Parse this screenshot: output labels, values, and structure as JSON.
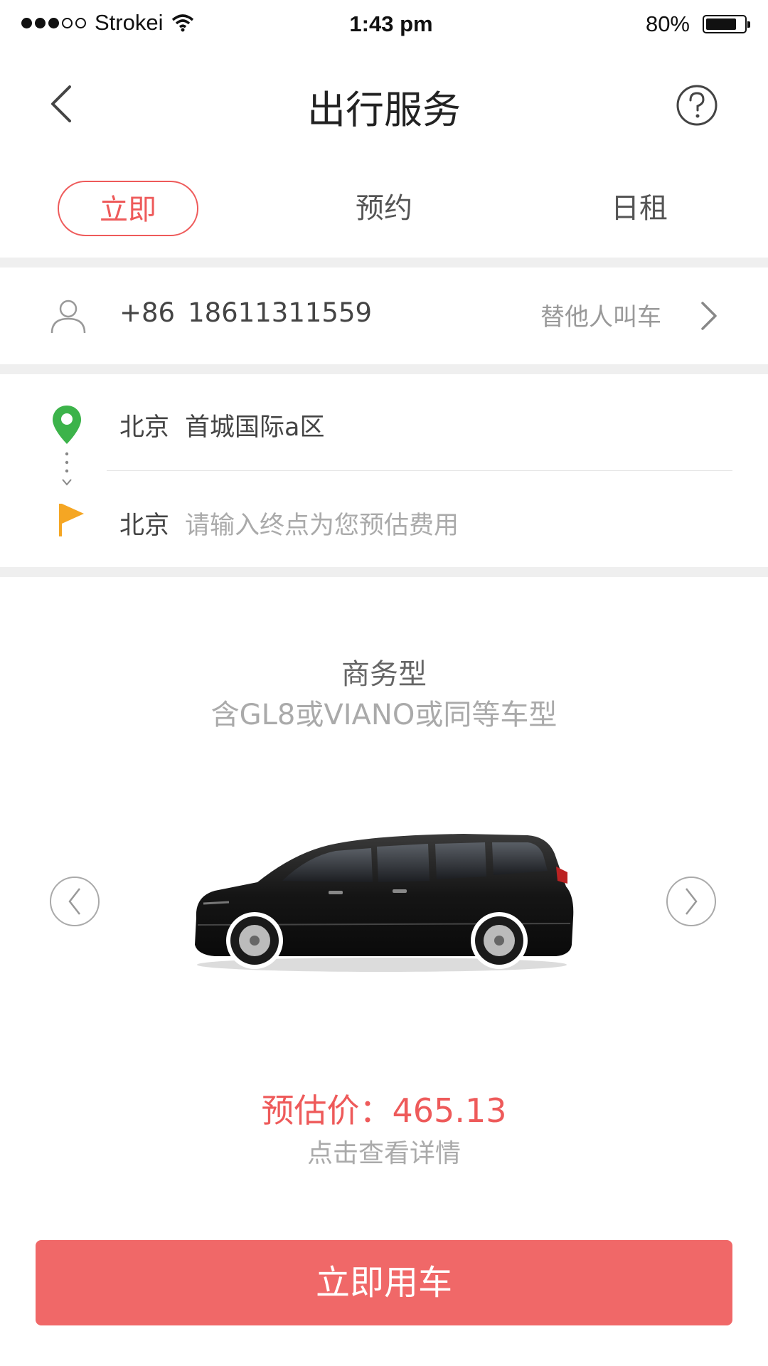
{
  "status_bar": {
    "carrier": "Strokei",
    "time": "1:43 pm",
    "battery": "80%",
    "battery_level": 0.8
  },
  "header": {
    "title": "出行服务",
    "back_icon": "chevron-left-icon",
    "help_icon": "question-circle-icon"
  },
  "tabs": [
    {
      "label": "立即",
      "active": true
    },
    {
      "label": "预约",
      "active": false
    },
    {
      "label": "日租",
      "active": false
    }
  ],
  "passenger": {
    "country_code": "+86",
    "phone": "18611311559",
    "other_label": "替他人叫车"
  },
  "route": {
    "start_city": "北京",
    "start_address": "首城国际a区",
    "end_city": "北京",
    "end_placeholder": "请输入终点为您预估费用"
  },
  "car": {
    "type": "商务型",
    "description": "含GL8或VIANO或同等车型"
  },
  "estimate": {
    "price_label": "预估价：465.13",
    "detail_link": "点击查看详情"
  },
  "cta": {
    "label": "立即用车"
  },
  "colors": {
    "accent": "#ee5a5a",
    "button": "#f06868",
    "start_pin": "#3cb34a",
    "end_flag": "#f5a623",
    "separator": "#efefef"
  }
}
